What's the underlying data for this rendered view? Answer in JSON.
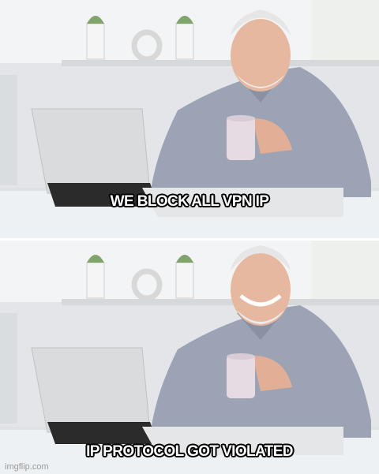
{
  "meme": {
    "panels": [
      {
        "caption": "WE BLOCK ALL VPN IP",
        "expression": "polite-smile"
      },
      {
        "caption": "IP PROTOCOL GOT VIOLATED",
        "expression": "pained-smile"
      }
    ],
    "watermark": "imgflip.com"
  }
}
